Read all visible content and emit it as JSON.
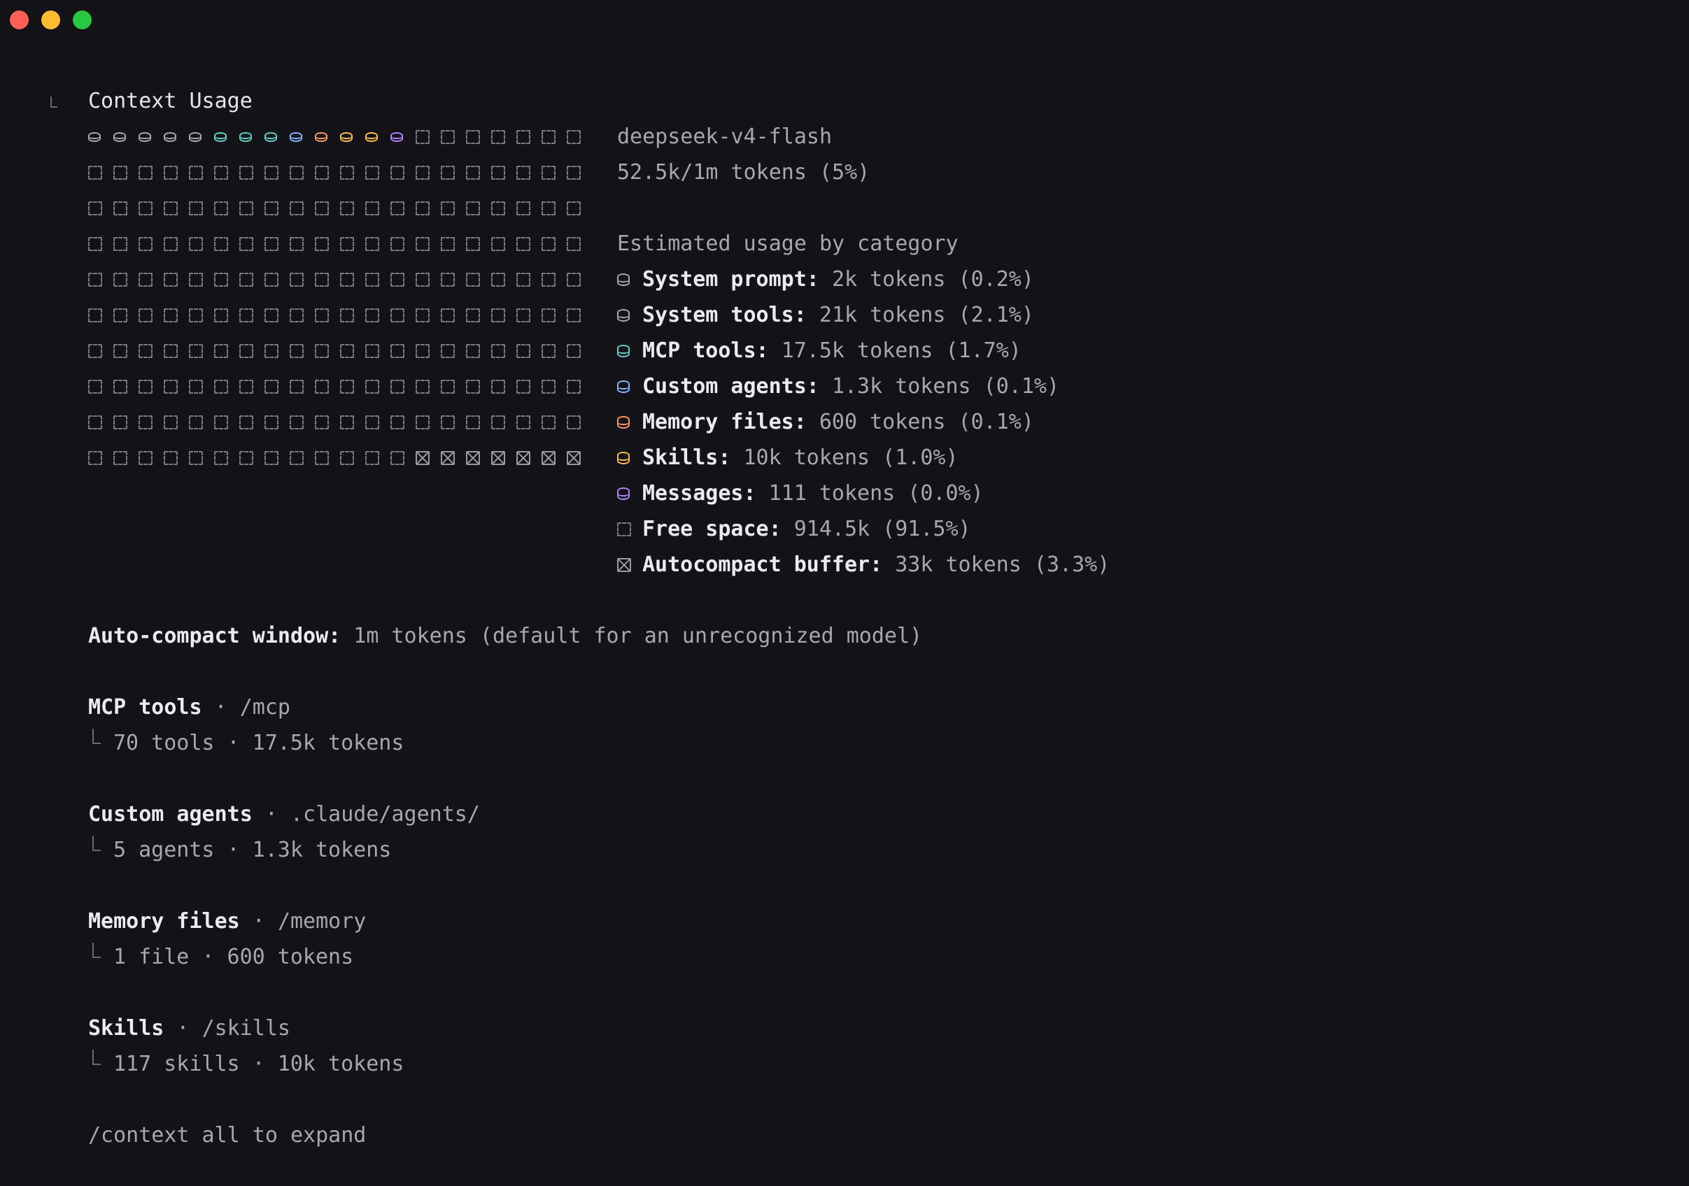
{
  "window": {
    "controls": [
      "close",
      "minimize",
      "zoom"
    ]
  },
  "context": {
    "title": "Context Usage",
    "model": "deepseek-v4-flash",
    "tokens_summary": "52.5k/1m tokens (5%)",
    "category_header": "Estimated usage by category",
    "grid": {
      "columns": 20,
      "rows": 10,
      "row1": [
        {
          "type": "db",
          "color": "#a8a8ae"
        },
        {
          "type": "db",
          "color": "#a8a8ae"
        },
        {
          "type": "db",
          "color": "#a8a8ae"
        },
        {
          "type": "db",
          "color": "#a8a8ae"
        },
        {
          "type": "db",
          "color": "#a8a8ae"
        },
        {
          "type": "db",
          "color": "#5fd2c8"
        },
        {
          "type": "db",
          "color": "#5fd2c8"
        },
        {
          "type": "db",
          "color": "#5fd2c8"
        },
        {
          "type": "db",
          "color": "#7fb4ff"
        },
        {
          "type": "db",
          "color": "#ff9a5c"
        },
        {
          "type": "db",
          "color": "#ffbf3c"
        },
        {
          "type": "db",
          "color": "#ffbf3c"
        },
        {
          "type": "db",
          "color": "#b281ff"
        }
      ],
      "buffer_cells_last_row": 7
    },
    "categories": [
      {
        "icon": "system-prompt-icon",
        "color": "#a8a8ae",
        "label": "System prompt:",
        "value": "2k tokens (0.2%)"
      },
      {
        "icon": "system-tools-icon",
        "color": "#a8a8ae",
        "label": "System tools:",
        "value": "21k tokens (2.1%)"
      },
      {
        "icon": "mcp-tools-icon",
        "color": "#5fd2c8",
        "label": "MCP tools:",
        "value": "17.5k tokens (1.7%)"
      },
      {
        "icon": "custom-agents-icon",
        "color": "#7fb4ff",
        "label": "Custom agents:",
        "value": "1.3k tokens (0.1%)"
      },
      {
        "icon": "memory-files-icon",
        "color": "#ff9a5c",
        "label": "Memory files:",
        "value": "600 tokens (0.1%)"
      },
      {
        "icon": "skills-icon",
        "color": "#ffbf3c",
        "label": "Skills:",
        "value": "10k tokens (1.0%)"
      },
      {
        "icon": "messages-icon",
        "color": "#b281ff",
        "label": "Messages:",
        "value": "111 tokens (0.0%)"
      },
      {
        "icon": "free-space-icon",
        "color": "#7a7a80",
        "label": "Free space:",
        "value": "914.5k (91.5%)"
      },
      {
        "icon": "autocompact-buffer-icon",
        "color": "#9a9aa0",
        "label": "Autocompact buffer:",
        "value": "33k tokens (3.3%)"
      }
    ],
    "autocompact": {
      "label": "Auto-compact window:",
      "value": "1m tokens (default for an unrecognized model)"
    },
    "sections": [
      {
        "title": "MCP tools",
        "sep": " · ",
        "path": "/mcp",
        "detail": "70 tools · 17.5k tokens"
      },
      {
        "title": "Custom agents",
        "sep": " · ",
        "path": ".claude/agents/",
        "detail": "5 agents · 1.3k tokens"
      },
      {
        "title": "Memory files",
        "sep": " · ",
        "path": "/memory",
        "detail": "1 file · 600 tokens"
      },
      {
        "title": "Skills",
        "sep": " · ",
        "path": "/skills",
        "detail": "117 skills · 10k tokens"
      }
    ],
    "footer_hint": "/context all to expand"
  }
}
